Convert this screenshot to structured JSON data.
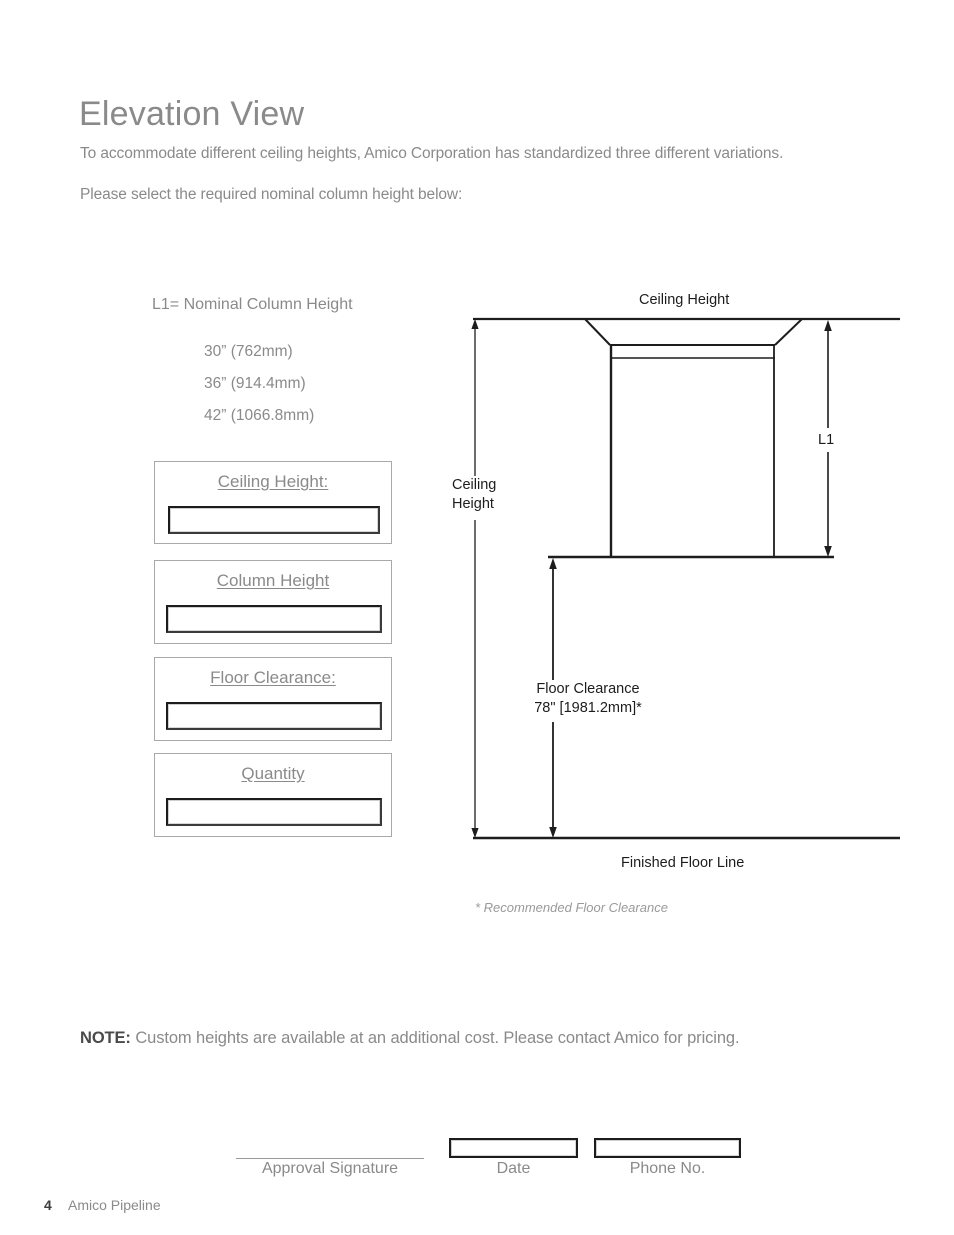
{
  "document": {
    "title": "Elevation View",
    "intro_line_1": "To accommodate different ceiling heights, Amico Corporation has standardized three different variations.",
    "intro_line_2": "Please select the required nominal column height below:"
  },
  "legend": {
    "l1_definition": "L1= Nominal Column Height",
    "height_options": [
      "30” (762mm)",
      "36” (914.4mm)",
      "42” (1066.8mm)"
    ]
  },
  "form_fields": [
    {
      "label": "Ceiling Height:",
      "value": "",
      "placeholder": ""
    },
    {
      "label": "Column Height",
      "value": "",
      "placeholder": ""
    },
    {
      "label": "Floor Clearance:",
      "value": "",
      "placeholder": ""
    },
    {
      "label": "Quantity",
      "value": "",
      "placeholder": ""
    }
  ],
  "diagram": {
    "ceiling_height_top_label": "Ceiling Height",
    "ceiling_height_side_label_line1": "Ceiling",
    "ceiling_height_side_label_line2": "Height",
    "l1_label": "L1",
    "floor_clearance_label_line1": "Floor Clearance",
    "floor_clearance_label_line2": "78\" [1981.2mm]*",
    "finished_floor_label": "Finished Floor Line",
    "footnote": "* Recommended Floor Clearance"
  },
  "note": {
    "prefix": "NOTE:",
    "text": "Custom heights are available at an additional cost. Please contact Amico for pricing."
  },
  "signature_row": [
    {
      "label": "Approval Signature",
      "value": "",
      "placeholder": "",
      "has_box": false
    },
    {
      "label": "Date",
      "value": "",
      "placeholder": "",
      "has_box": true
    },
    {
      "label": "Phone No.",
      "value": "",
      "placeholder": "",
      "has_box": true
    }
  ],
  "footer": {
    "page_number": "4",
    "brand": "Amico Pipeline"
  },
  "colors": {
    "body_text": "#8a8a8a",
    "heading": "#8a8a8a",
    "diagram_line": "#1d1d1d",
    "note_emphasis": "#4a4a4a"
  }
}
